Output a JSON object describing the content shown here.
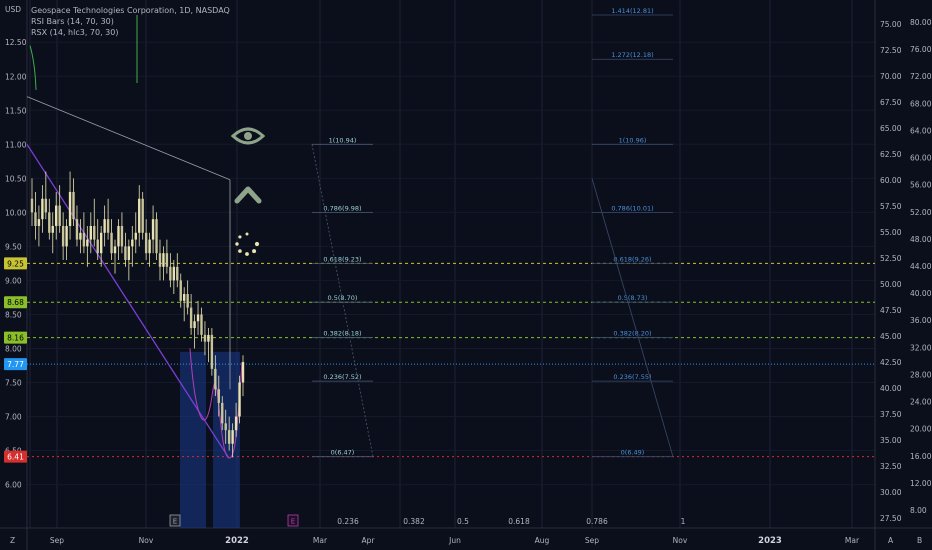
{
  "header": {
    "currency": "USD",
    "title_line": "Geospace Technologies Corporation, 1D, NASDAQ",
    "indicator_1": "RSI Bars (14, 70, 30)",
    "indicator_2": "RSX (14, hlc3, 70, 30)"
  },
  "colors": {
    "background": "#0b0f1c",
    "candles": "#e8e3b0",
    "grid": "#1c2233",
    "fib_text": "#9ad0d6",
    "fib_text_right": "#4a90d9",
    "level_yellow": "#c7c433",
    "level_green": "#8bbf2a",
    "current_price": "#2196f3",
    "low_line": "#d62d2d",
    "trend_purple": "#7b3fd9",
    "shade_blue": "#1a3a8c"
  },
  "chart_data": {
    "type": "candlestick",
    "x_ticks": [
      "Sep",
      "Nov",
      "2022",
      "Mar",
      "Apr",
      "Jun",
      "Aug",
      "Sep",
      "Nov",
      "2023",
      "Mar"
    ],
    "y_left_ticks": [
      "12.50",
      "12.00",
      "11.50",
      "11.00",
      "10.50",
      "10.00",
      "9.50",
      "9.00",
      "8.50",
      "8.00",
      "7.50",
      "7.00",
      "6.50",
      "6.00"
    ],
    "y_left_range": [
      5.7,
      12.9
    ],
    "y_right_a_ticks": [
      "75.00",
      "72.50",
      "70.00",
      "67.50",
      "65.00",
      "62.50",
      "60.00",
      "57.50",
      "55.00",
      "52.50",
      "50.00",
      "47.50",
      "45.00",
      "42.50",
      "40.00",
      "37.50",
      "35.00",
      "32.50",
      "30.00",
      "27.50"
    ],
    "y_right_b_ticks": [
      "80.00",
      "76.00",
      "72.00",
      "68.00",
      "64.00",
      "60.00",
      "56.00",
      "52.00",
      "48.00",
      "44.00",
      "40.00",
      "36.00",
      "32.00",
      "28.00",
      "24.00",
      "20.00",
      "16.00",
      "12.00",
      "8.00"
    ],
    "price_tags": [
      {
        "label": "9.25",
        "price": 9.25,
        "color": "#c7c433",
        "text_color": "#000000"
      },
      {
        "label": "8.68",
        "price": 8.68,
        "color": "#8bbf2a",
        "text_color": "#000000"
      },
      {
        "label": "8.16",
        "price": 8.16,
        "color": "#8bbf2a",
        "text_color": "#000000"
      },
      {
        "label": "7.77",
        "price": 7.77,
        "color": "#2196f3",
        "text_color": "#ffffff"
      },
      {
        "label": "6.41",
        "price": 6.41,
        "color": "#d62d2d",
        "text_color": "#ffffff"
      }
    ],
    "fib_left": [
      {
        "label": "1(10.94)",
        "price": 11.0
      },
      {
        "label": "0.786(9.98)",
        "price": 10.0
      },
      {
        "label": "0.618(9.23)",
        "price": 9.25
      },
      {
        "label": "0.5(8.70)",
        "price": 8.68
      },
      {
        "label": "0.382(8.18)",
        "price": 8.16
      },
      {
        "label": "0.236(7.52)",
        "price": 7.52
      },
      {
        "label": "0(6.47)",
        "price": 6.41
      }
    ],
    "fib_right": [
      {
        "label": "1.414(12.81)",
        "price": 12.9
      },
      {
        "label": "1.272(12.18)",
        "price": 12.25
      },
      {
        "label": "1(10.96)",
        "price": 11.0
      },
      {
        "label": "0.786(10.01)",
        "price": 10.0
      },
      {
        "label": "0.618(9.26)",
        "price": 9.25
      },
      {
        "label": "0.5(8.73)",
        "price": 8.68
      },
      {
        "label": "0.382(8.20)",
        "price": 8.16
      },
      {
        "label": "0.236(7.55)",
        "price": 7.52
      },
      {
        "label": "0(6.49)",
        "price": 6.41
      }
    ],
    "bottom_labels": [
      "0.236",
      "0.382",
      "0.5",
      "0.618",
      "0.786",
      "1"
    ],
    "event_markers": [
      "E",
      "E"
    ],
    "corner_left": "Z",
    "corner_right": [
      "A",
      "B"
    ],
    "icons": [
      "eye-icon",
      "chevron-up-icon",
      "loading-dots-icon"
    ],
    "candles_daily": [
      [
        10.2,
        10.5,
        9.8,
        10.0
      ],
      [
        10.0,
        10.3,
        9.6,
        9.8
      ],
      [
        9.8,
        10.1,
        9.5,
        9.9
      ],
      [
        9.9,
        10.4,
        9.7,
        10.2
      ],
      [
        10.2,
        10.6,
        9.9,
        10.0
      ],
      [
        10.0,
        10.2,
        9.6,
        9.7
      ],
      [
        9.7,
        10.0,
        9.4,
        9.8
      ],
      [
        9.8,
        10.3,
        9.6,
        10.1
      ],
      [
        10.1,
        10.4,
        9.7,
        9.8
      ],
      [
        9.8,
        10.0,
        9.3,
        9.5
      ],
      [
        9.5,
        9.9,
        9.3,
        9.8
      ],
      [
        9.8,
        10.6,
        9.6,
        10.3
      ],
      [
        10.3,
        10.5,
        9.8,
        9.9
      ],
      [
        9.9,
        10.1,
        9.5,
        9.6
      ],
      [
        9.6,
        9.9,
        9.4,
        9.7
      ],
      [
        9.7,
        10.0,
        9.4,
        9.5
      ],
      [
        9.5,
        9.8,
        9.2,
        9.6
      ],
      [
        9.6,
        10.0,
        9.4,
        9.8
      ],
      [
        9.8,
        10.2,
        9.5,
        9.6
      ],
      [
        9.6,
        9.9,
        9.3,
        9.4
      ],
      [
        9.4,
        9.8,
        9.2,
        9.7
      ],
      [
        9.7,
        10.1,
        9.5,
        9.9
      ],
      [
        9.9,
        10.2,
        9.6,
        9.7
      ],
      [
        9.7,
        9.9,
        9.3,
        9.4
      ],
      [
        9.4,
        9.6,
        9.1,
        9.5
      ],
      [
        9.5,
        9.9,
        9.3,
        9.8
      ],
      [
        9.8,
        10.0,
        9.4,
        9.5
      ],
      [
        9.5,
        9.7,
        9.2,
        9.3
      ],
      [
        9.3,
        9.6,
        9.0,
        9.5
      ],
      [
        9.5,
        9.8,
        9.2,
        9.6
      ],
      [
        9.6,
        10.0,
        9.4,
        9.7
      ],
      [
        9.7,
        10.4,
        9.5,
        10.2
      ],
      [
        10.2,
        10.3,
        9.6,
        9.7
      ],
      [
        9.7,
        9.9,
        9.3,
        9.4
      ],
      [
        9.4,
        9.7,
        9.2,
        9.6
      ],
      [
        9.6,
        10.1,
        9.4,
        9.9
      ],
      [
        9.9,
        10.0,
        9.3,
        9.4
      ],
      [
        9.4,
        9.6,
        9.0,
        9.2
      ],
      [
        9.2,
        9.5,
        9.0,
        9.4
      ],
      [
        9.4,
        9.6,
        9.1,
        9.2
      ],
      [
        9.2,
        9.4,
        8.9,
        9.0
      ],
      [
        9.0,
        9.3,
        8.8,
        9.2
      ],
      [
        9.2,
        9.4,
        8.9,
        9.0
      ],
      [
        9.0,
        9.1,
        8.6,
        8.7
      ],
      [
        8.7,
        8.9,
        8.4,
        8.8
      ],
      [
        8.8,
        9.0,
        8.5,
        8.6
      ],
      [
        8.6,
        8.8,
        8.2,
        8.3
      ],
      [
        8.3,
        8.5,
        8.0,
        8.4
      ],
      [
        8.4,
        8.7,
        8.2,
        8.5
      ],
      [
        8.5,
        8.6,
        8.1,
        8.2
      ],
      [
        8.2,
        8.4,
        7.9,
        8.1
      ],
      [
        8.1,
        8.3,
        7.8,
        8.2
      ],
      [
        8.2,
        8.3,
        7.6,
        7.7
      ],
      [
        7.7,
        7.9,
        7.3,
        7.4
      ],
      [
        7.4,
        7.6,
        7.0,
        7.2
      ],
      [
        7.2,
        7.3,
        6.8,
        6.9
      ],
      [
        6.9,
        7.1,
        6.6,
        6.8
      ],
      [
        6.8,
        7.0,
        6.5,
        6.6
      ],
      [
        6.6,
        6.9,
        6.4,
        6.8
      ],
      [
        6.8,
        7.2,
        6.7,
        7.0
      ],
      [
        7.0,
        7.6,
        6.9,
        7.5
      ],
      [
        7.5,
        7.9,
        7.3,
        7.8
      ]
    ]
  }
}
